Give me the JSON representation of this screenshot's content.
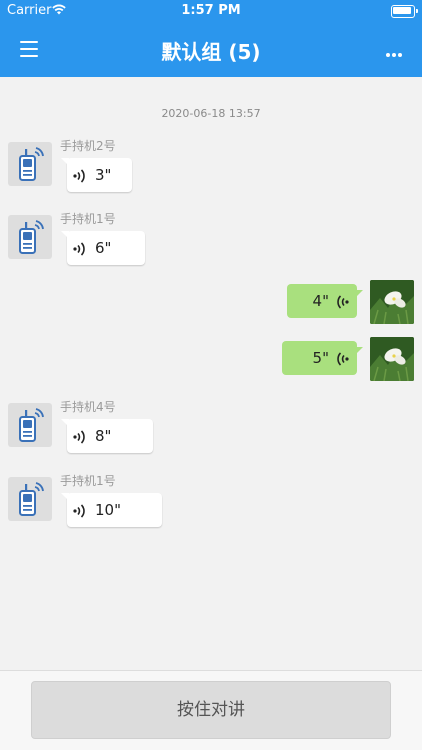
{
  "status_bar": {
    "carrier": "Carrier",
    "time": "1:57 PM"
  },
  "header": {
    "title": "默认组 (5)",
    "menu_icon": "hamburger-menu-icon",
    "more_icon": "more-dots-icon",
    "background": "#2b96ed"
  },
  "chat": {
    "timestamp": "2020-06-18 13:57",
    "messages": [
      {
        "direction": "incoming",
        "sender": "手持机2号",
        "duration": "3\""
      },
      {
        "direction": "incoming",
        "sender": "手持机1号",
        "duration": "6\""
      },
      {
        "direction": "outgoing",
        "duration": "4\""
      },
      {
        "direction": "outgoing",
        "duration": "5\""
      },
      {
        "direction": "incoming",
        "sender": "手持机4号",
        "duration": "8\""
      },
      {
        "direction": "incoming",
        "sender": "手持机1号",
        "duration": "10\""
      }
    ],
    "incoming_avatar_icon": "walkie-talkie-icon",
    "outgoing_bubble_color": "#a9e07e"
  },
  "bottom": {
    "ptt_label": "按住对讲"
  }
}
